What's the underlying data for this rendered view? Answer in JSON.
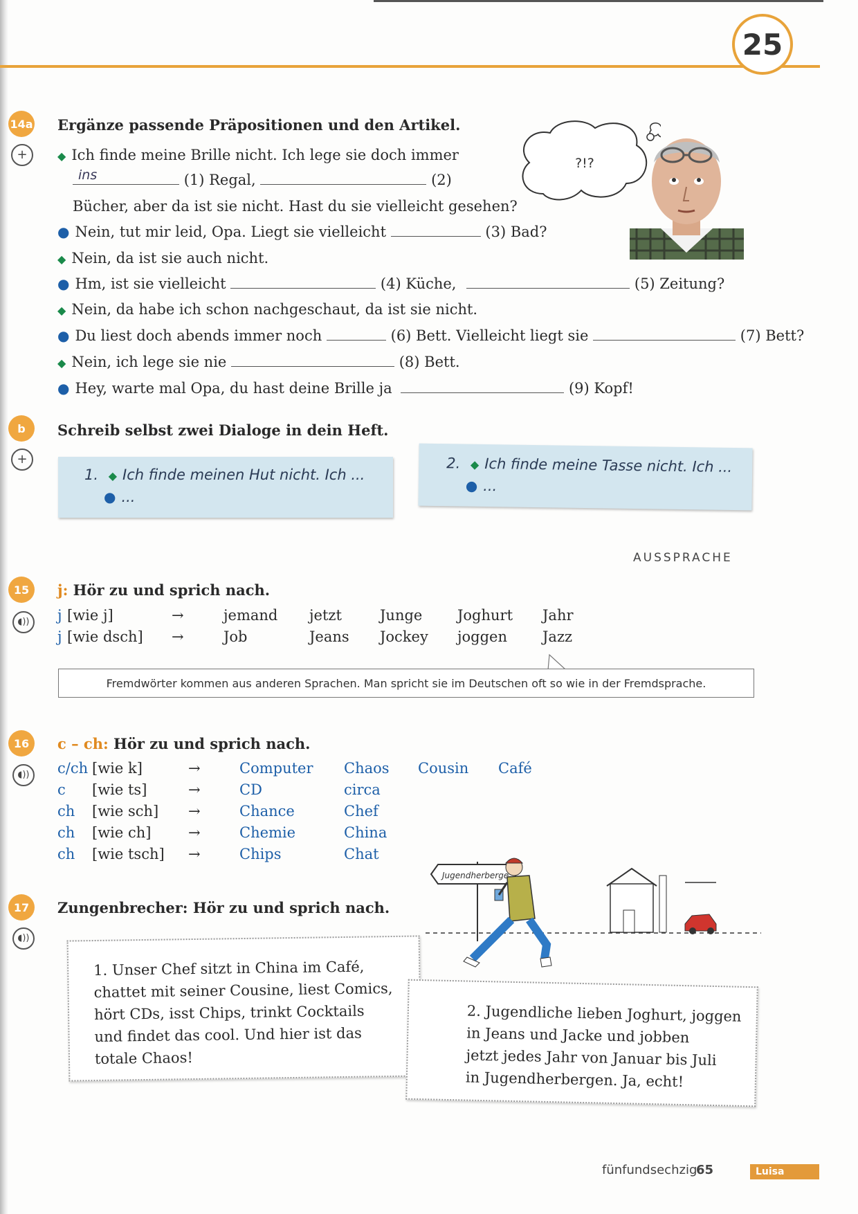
{
  "page": {
    "chapter_number": "25",
    "page_word": "fünfundsechzig",
    "page_number": "65",
    "tab_label": "Luisa"
  },
  "ex14a": {
    "badge": "14a",
    "title": "Ergänze passende Präpositionen und den Artikel.",
    "thought": "?!?",
    "line1": "Ich finde meine Brille nicht. Ich lege sie doch immer",
    "answer1": "ins",
    "l2_n1": "(1) Regal,",
    "l2_n2": "(2)",
    "line3": "Bücher, aber da ist sie nicht. Hast du sie vielleicht gesehen?",
    "line4a": "Nein, tut mir leid, Opa. Liegt sie vielleicht",
    "line4b": "(3) Bad?",
    "line5": "Nein, da ist sie auch nicht.",
    "line6a": "Hm, ist sie vielleicht",
    "line6b": "(4) Küche,",
    "line6c": "(5) Zeitung?",
    "line7": "Nein, da habe ich schon nachgeschaut, da ist sie nicht.",
    "line8a": "Du liest doch abends immer noch",
    "line8b": "(6) Bett. Vielleicht liegt sie",
    "line8c": "(7) Bett?",
    "line9a": "Nein, ich lege sie nie",
    "line9b": "(8) Bett.",
    "line10a": "Hey, warte mal Opa, du hast deine Brille ja",
    "line10b": "(9) Kopf!"
  },
  "ex14b": {
    "badge": "b",
    "title": "Schreib selbst zwei Dialoge in dein Heft.",
    "note1_num": "1.",
    "note1_line1": "Ich finde meinen Hut nicht. Ich ...",
    "note1_line2": "...",
    "note2_num": "2.",
    "note2_line1": "Ich finde meine Tasse nicht. Ich ...",
    "note2_line2": "..."
  },
  "section_label": "AUSSPRACHE",
  "ex15": {
    "badge": "15",
    "title_prefix": "j:",
    "title": "Hör zu und sprich nach.",
    "rows": [
      {
        "letter": "j",
        "sound": "[wie j]",
        "arrow": "→",
        "words": [
          "jemand",
          "jetzt",
          "Junge",
          "Joghurt",
          "Jahr"
        ]
      },
      {
        "letter": "j",
        "sound": "[wie dsch]",
        "arrow": "→",
        "words": [
          "Job",
          "Jeans",
          "Jockey",
          "joggen",
          "Jazz"
        ]
      }
    ],
    "info": "Fremdwörter kommen aus anderen Sprachen. Man spricht sie im Deutschen oft so wie in der Fremdsprache."
  },
  "ex16": {
    "badge": "16",
    "title_prefix": "c – ch:",
    "title": "Hör zu und sprich nach.",
    "rows": [
      {
        "letter": "c/ch",
        "sound": "[wie k]",
        "arrow": "→",
        "words": [
          "Computer",
          "Chaos",
          "Cousin",
          "Café"
        ]
      },
      {
        "letter": "c",
        "sound": "[wie ts]",
        "arrow": "→",
        "words": [
          "CD",
          "circa"
        ]
      },
      {
        "letter": "ch",
        "sound": "[wie sch]",
        "arrow": "→",
        "words": [
          "Chance",
          "Chef"
        ]
      },
      {
        "letter": "ch",
        "sound": "[wie ch]",
        "arrow": "→",
        "words": [
          "Chemie",
          "China"
        ]
      },
      {
        "letter": "ch",
        "sound": "[wie tsch]",
        "arrow": "→",
        "words": [
          "Chips",
          "Chat"
        ]
      }
    ]
  },
  "ex17": {
    "badge": "17",
    "title": "Zungenbrecher: Hör zu und sprich nach.",
    "sign": "Jugendherberge",
    "box1": [
      "1. Unser Chef sitzt in China im Café,",
      "chattet mit seiner Cousine, liest Comics,",
      "hört CDs, isst Chips, trinkt Cocktails",
      "und findet das cool. Und hier ist das",
      "totale Chaos!"
    ],
    "box2": [
      "2. Jugendliche lieben Joghurt, joggen",
      "in Jeans und Jacke und jobben",
      "jetzt jedes Jahr von Januar bis Juli",
      "in Jugendherbergen. Ja, echt!"
    ]
  },
  "icons": [
    "plus-circle-icon",
    "audio-icon",
    "thought-bubble-icon",
    "grandpa-photo",
    "walking-boy-illustration"
  ],
  "colors": {
    "accent": "#e8a33a",
    "badge": "#f0a740",
    "blue": "#1d5fa8",
    "green": "#1a8a4a",
    "note": "#d3e6ef"
  }
}
